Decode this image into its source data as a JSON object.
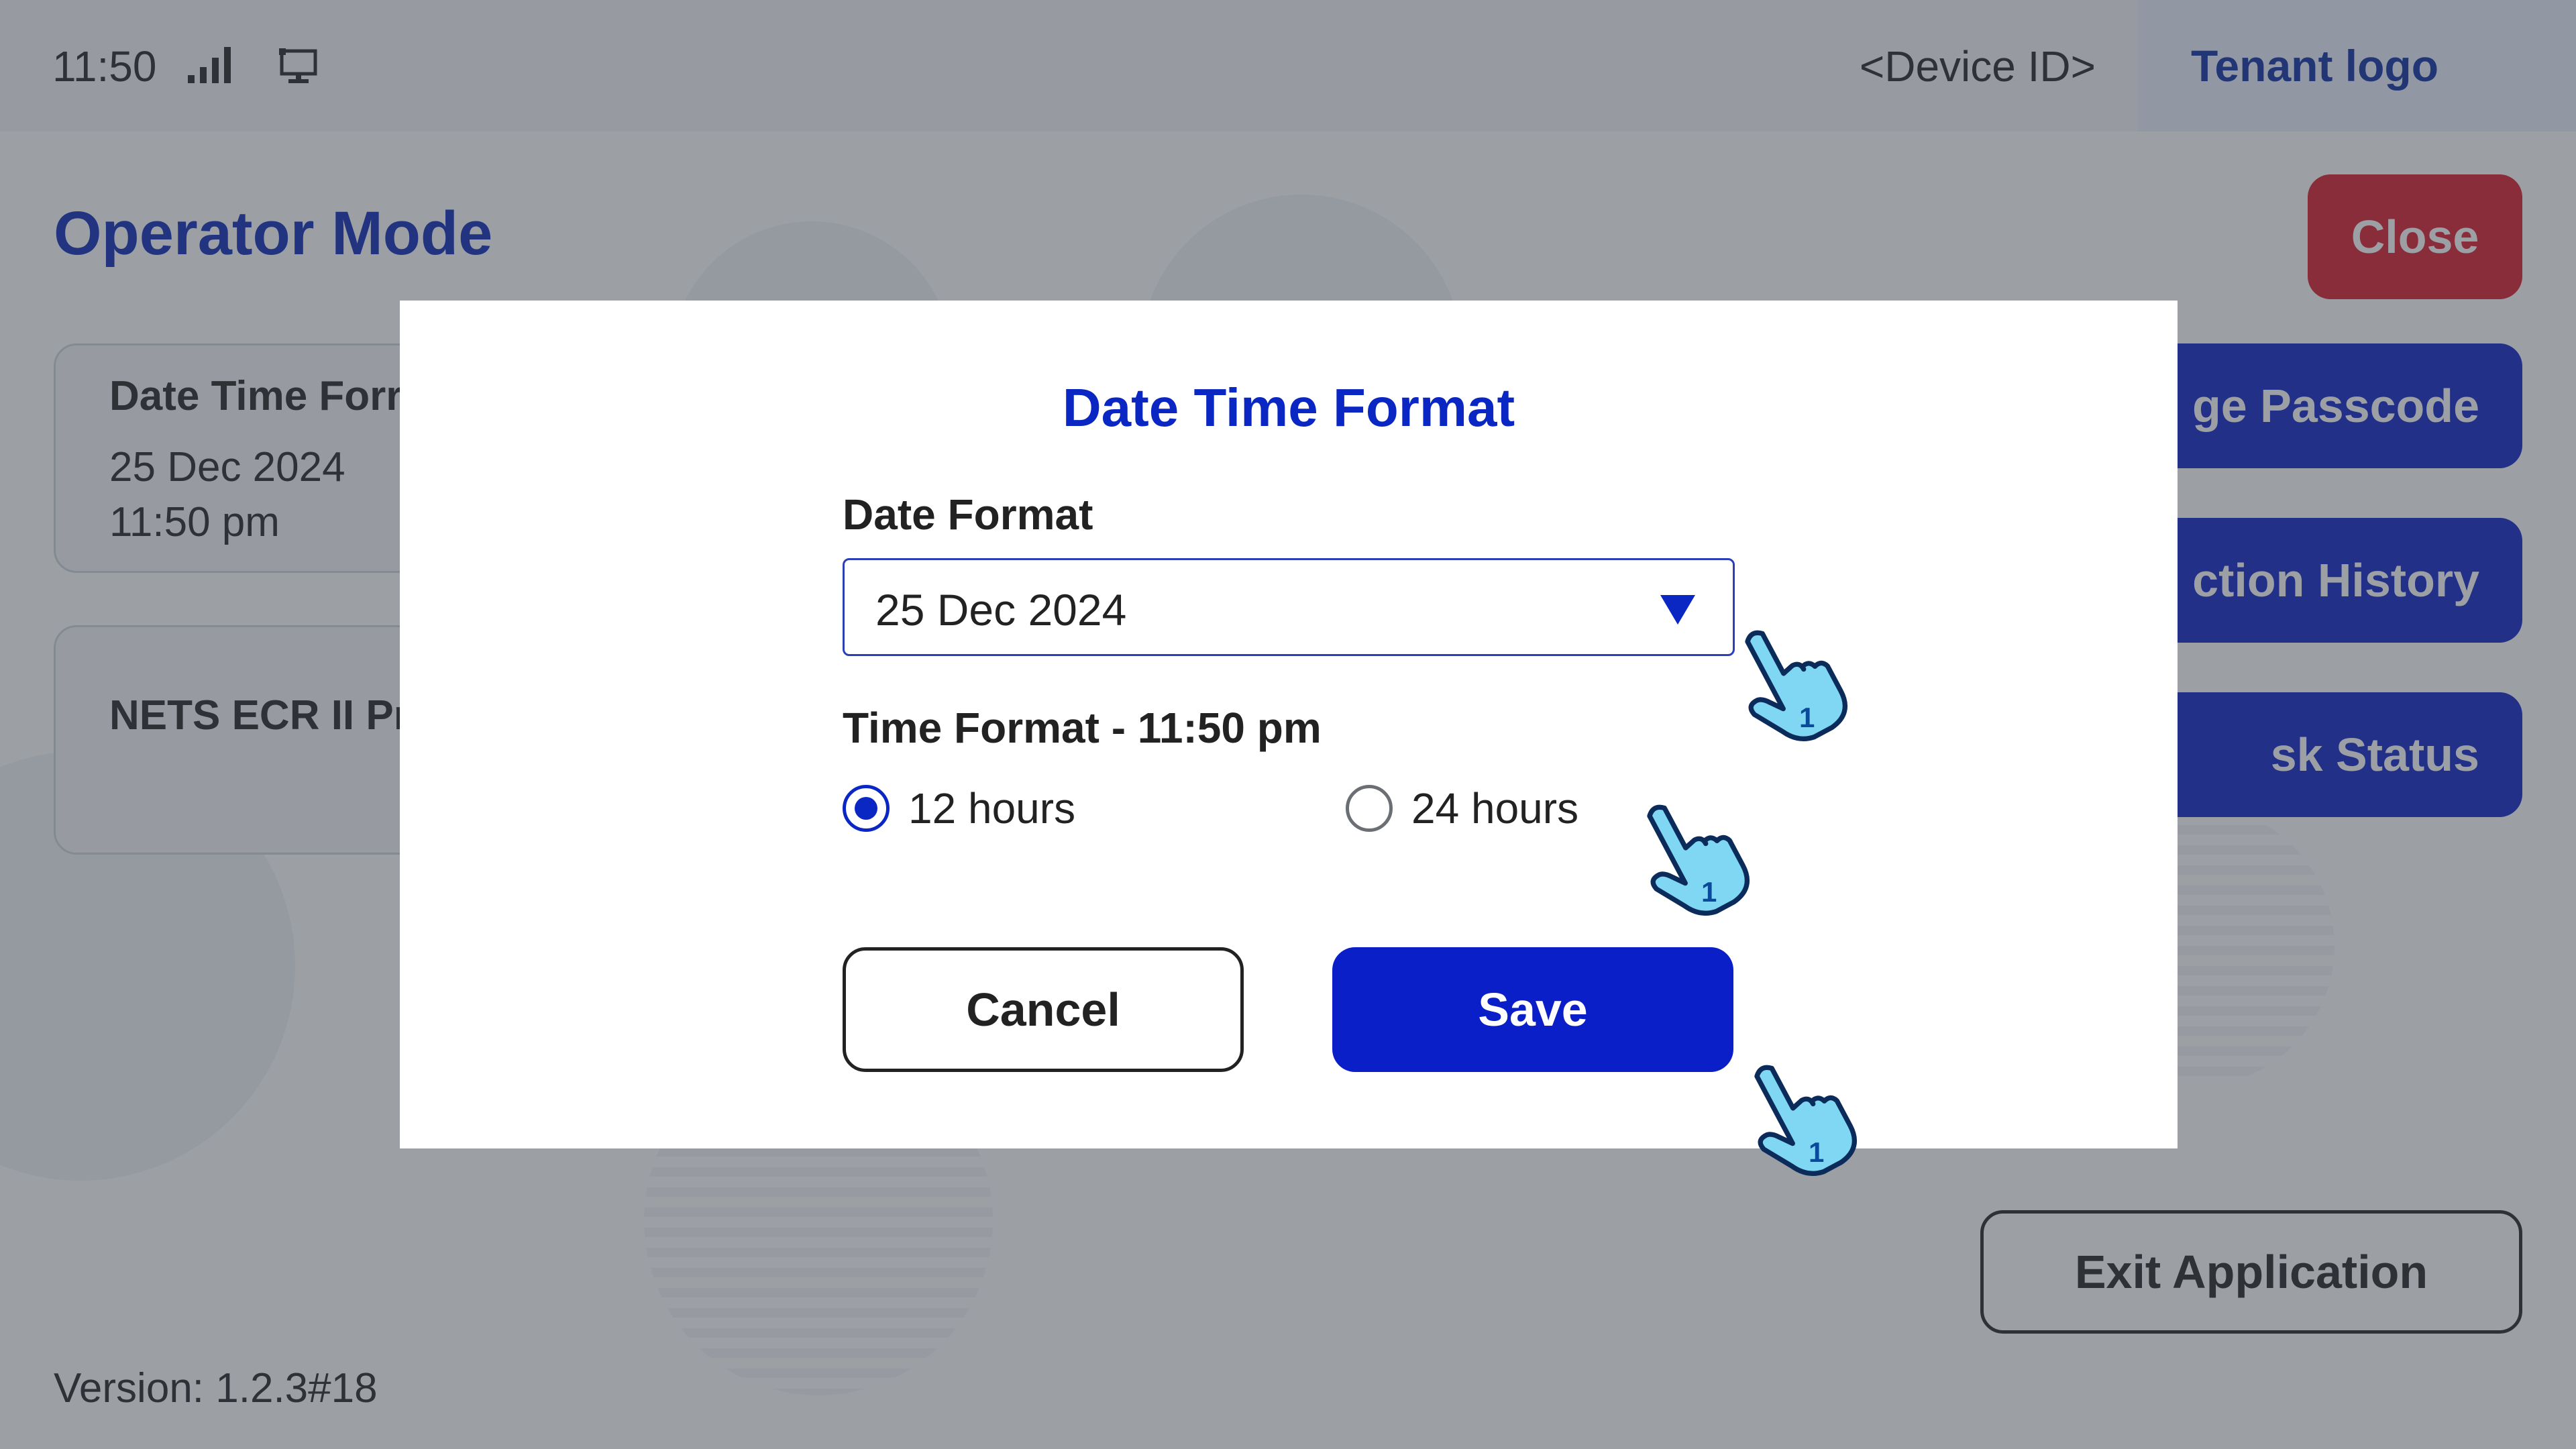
{
  "status_bar": {
    "time": "11:50",
    "signal_icon": "signal-bars-icon",
    "screen_icon": "monitor-icon",
    "device_id": "<Device ID>",
    "tenant_logo": "Tenant logo"
  },
  "page": {
    "title": "Operator Mode",
    "close_label": "Close",
    "version": "Version: 1.2.3#18",
    "exit_label": "Exit Application"
  },
  "cards": [
    {
      "title": "Date Time Forr",
      "line1": "25 Dec 2024",
      "line2": "11:50 pm"
    },
    {
      "title": "NETS ECR II Pr Terminal"
    }
  ],
  "side_buttons": [
    {
      "label": "ge Passcode"
    },
    {
      "label": "ction History"
    },
    {
      "label": "sk Status"
    }
  ],
  "dialog": {
    "title": "Date Time Format",
    "date_label": "Date Format",
    "date_value": "25 Dec 2024",
    "time_label": "Time Format - 11:50 pm",
    "options": [
      {
        "label": "12 hours",
        "selected": true
      },
      {
        "label": "24 hours",
        "selected": false
      }
    ],
    "cancel_label": "Cancel",
    "save_label": "Save"
  },
  "colors": {
    "primary": "#0a1fc8",
    "title_blue": "#0a27c4",
    "close_red": "#d8192a",
    "hand_cursor": "#7fd7f4"
  },
  "icons": {
    "dropdown": "triangle-down-icon",
    "pointer": "tap-hand-icon",
    "pointer_badge": "1"
  }
}
